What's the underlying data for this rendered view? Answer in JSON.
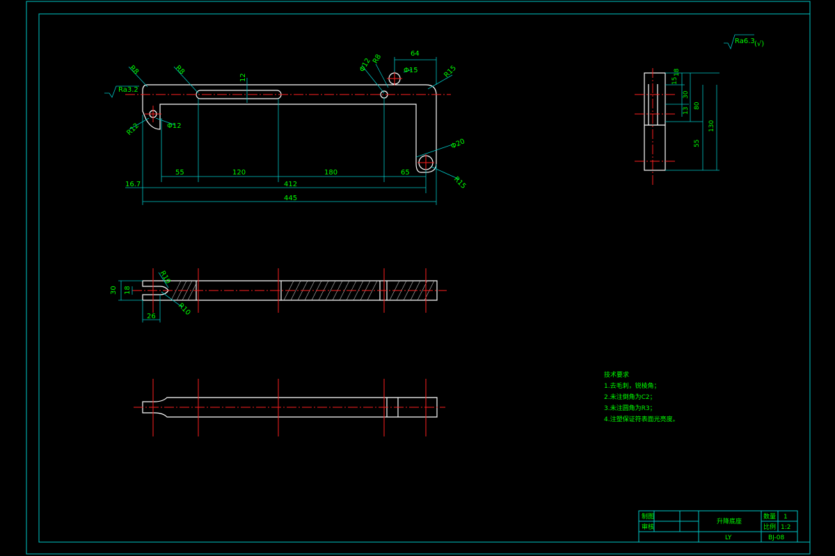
{
  "roughness": {
    "global": "Ra6.3",
    "global_paren": "(√)",
    "edge": "Ra3.2"
  },
  "top_view": {
    "dims": {
      "d64": "64",
      "phi15": "Φ15",
      "r15a": "R15",
      "phi12a": "Φ12",
      "r8a": "R8",
      "r8b": "R8",
      "r8c": "R8",
      "w12": "12",
      "r12": "R12",
      "phi12b": "Φ12",
      "phi20": "Φ20",
      "r15b": "R15",
      "d55": "55",
      "d120": "120",
      "d180": "180",
      "d65": "65",
      "d16_7": "16.7",
      "d412": "412",
      "d445": "445"
    }
  },
  "side_view": {
    "dims": {
      "d15": "15",
      "d18": "18",
      "d30": "30",
      "d13": "13",
      "d80": "80",
      "d55": "55",
      "d130": "130"
    }
  },
  "section_view": {
    "dims": {
      "r10a": "R10",
      "r10b": "R10",
      "d30": "30",
      "d18": "18",
      "d26": "26"
    }
  },
  "notes": {
    "title": "技术要求",
    "items": [
      "1.去毛刺，锐棱角；",
      "2.未注倒角为C2；",
      "3.未注圆角为R3；",
      "4.注塑保证符表面光亮度。"
    ]
  },
  "title_block": {
    "drawn_label": "制图",
    "checked_label": "审核",
    "part_name": "升降底座",
    "qty_label": "数量",
    "qty_value": "1",
    "scale_label": "比例",
    "scale_value": "1:2",
    "author": "LY",
    "drawing_no": "BJ-08"
  }
}
